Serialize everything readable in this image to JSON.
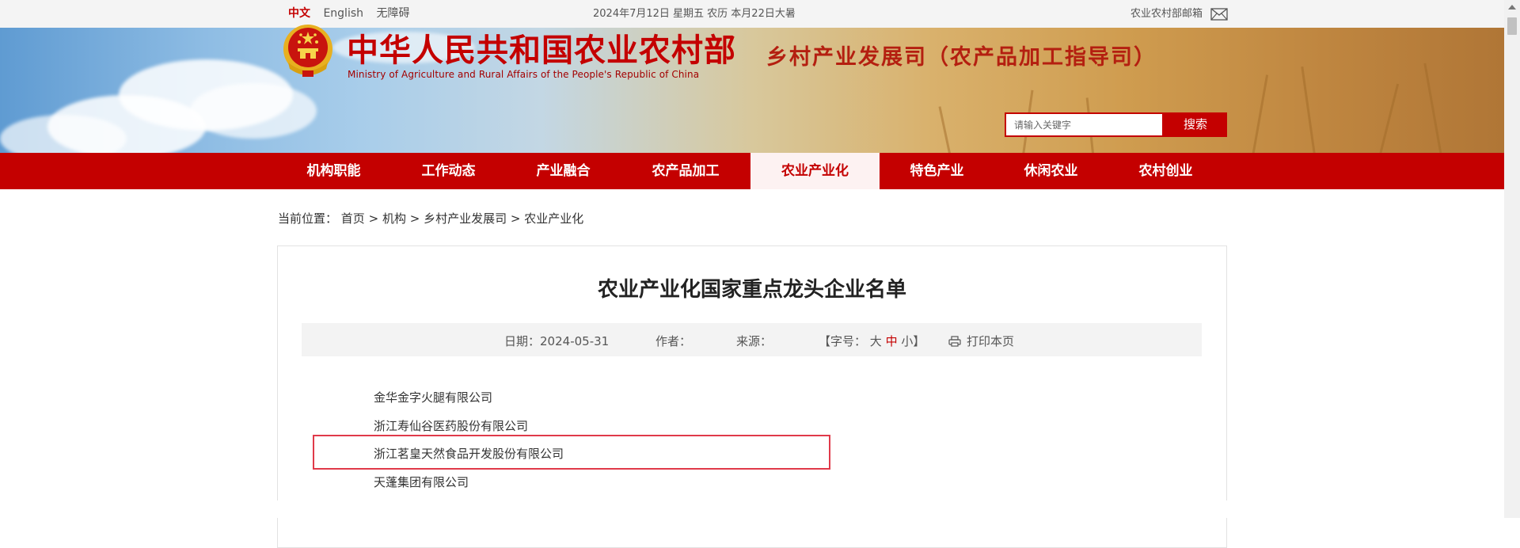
{
  "topbar": {
    "langs": [
      "中文",
      "English",
      "无障碍"
    ],
    "date": "2024年7月12日 星期五 农历 本月22日大暑",
    "mailbox": "农业农村部邮箱"
  },
  "header": {
    "title_cn": "中华人民共和国农业农村部",
    "title_en": "Ministry of Agriculture and Rural Affairs of the People's Republic of China",
    "dept": "乡村产业发展司（农产品加工指导司）",
    "search_placeholder": "请输入关键字",
    "search_button": "搜索"
  },
  "nav": {
    "items": [
      "机构职能",
      "工作动态",
      "产业融合",
      "农产品加工",
      "农业产业化",
      "特色产业",
      "休闲农业",
      "农村创业"
    ],
    "active_index": 4
  },
  "breadcrumb": {
    "prefix": "当前位置：",
    "items": [
      "首页",
      "机构",
      "乡村产业发展司",
      "农业产业化"
    ],
    "sep": ">"
  },
  "article": {
    "title": "农业产业化国家重点龙头企业名单",
    "date_label": "日期：",
    "date": "2024-05-31",
    "author_label": "作者：",
    "source_label": "来源：",
    "font_size_label": "【字号：",
    "font_sizes": [
      "大",
      "中",
      "小"
    ],
    "font_size_close": "】",
    "print_label": "打印本页",
    "companies": [
      "金华金字火腿有限公司",
      "浙江寿仙谷医药股份有限公司",
      "浙江茗皇天然食品开发股份有限公司",
      "天蓬集团有限公司"
    ],
    "highlighted_index": 2
  },
  "colors": {
    "brand_red": "#c40000",
    "highlight_border": "#e03a4a"
  }
}
